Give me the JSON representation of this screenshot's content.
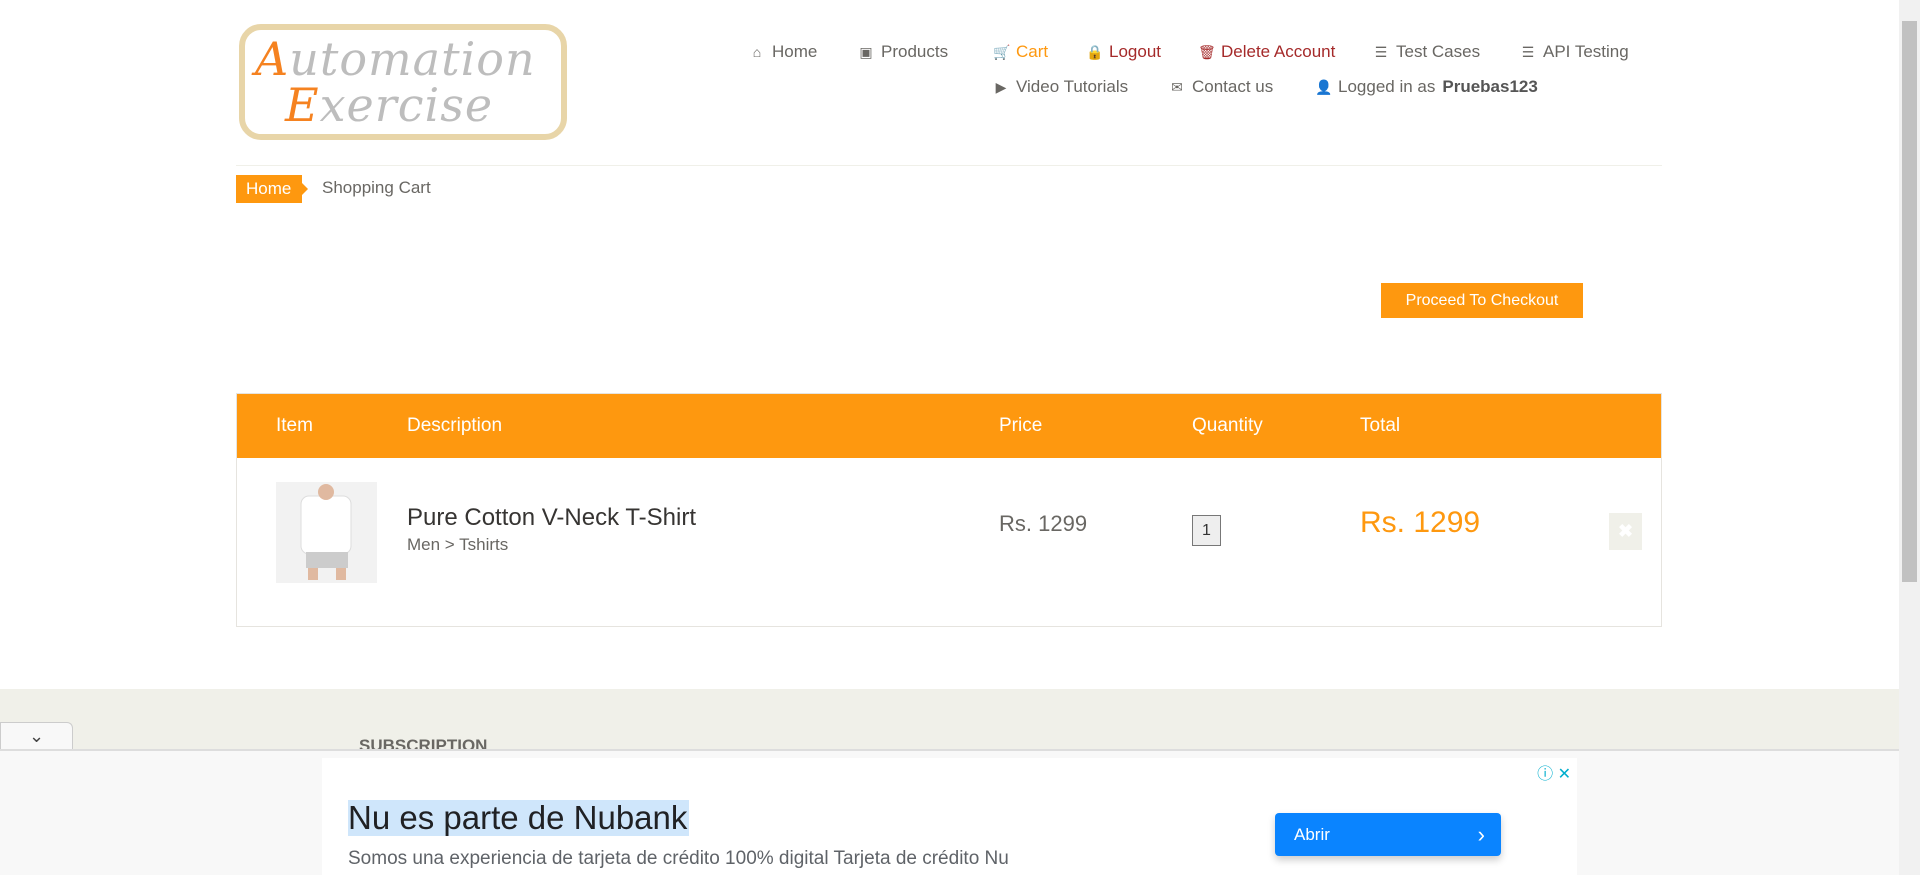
{
  "logo": {
    "line1_first": "A",
    "line1_rest": "utomation",
    "line2_first": "E",
    "line2_rest": "xercise"
  },
  "nav": {
    "items": [
      {
        "label": "Home",
        "icon": "home-icon",
        "glyph": "⌂",
        "color": "#696763"
      },
      {
        "label": "Products",
        "icon": "briefcase-icon",
        "glyph": "▣",
        "color": "#696763"
      },
      {
        "label": "Cart",
        "icon": "cart-icon",
        "glyph": "🛒",
        "color": "#fe980f"
      },
      {
        "label": "Logout",
        "icon": "lock-icon",
        "glyph": "🔒",
        "color": "#a52a2a"
      },
      {
        "label": "Delete Account",
        "icon": "trash-icon",
        "glyph": "🗑",
        "color": "#a52a2a"
      },
      {
        "label": "Test Cases",
        "icon": "list-icon",
        "glyph": "☰",
        "color": "#696763"
      },
      {
        "label": "API Testing",
        "icon": "list-icon",
        "glyph": "☰",
        "color": "#696763"
      },
      {
        "label": "Video Tutorials",
        "icon": "youtube-icon",
        "glyph": "▶",
        "color": "#696763"
      },
      {
        "label": "Contact us",
        "icon": "envelope-icon",
        "glyph": "✉",
        "color": "#696763"
      }
    ],
    "logged_prefix": "Logged in as",
    "username": "Pruebas123"
  },
  "breadcrumb": {
    "home": "Home",
    "current": "Shopping Cart"
  },
  "checkout_label": "Proceed To Checkout",
  "table": {
    "headers": [
      "Item",
      "Description",
      "Price",
      "Quantity",
      "Total"
    ],
    "rows": [
      {
        "name": "Pure Cotton V-Neck T-Shirt",
        "category": "Men > Tshirts",
        "price": "Rs. 1299",
        "quantity": "1",
        "total": "Rs. 1299"
      }
    ]
  },
  "footer": {
    "subscription": "SUBSCRIPTION"
  },
  "ad": {
    "headline": "Nu es parte de Nubank",
    "body": "Somos una experiencia de tarjeta de crédito 100% digital Tarjeta de crédito Nu",
    "button": "Abrir"
  },
  "colors": {
    "accent": "#fe980f",
    "danger": "#a52a2a",
    "ad_button": "#0a84ff"
  }
}
